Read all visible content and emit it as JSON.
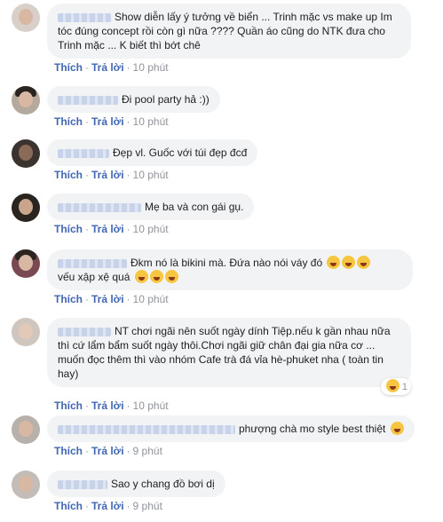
{
  "labels": {
    "like": "Thích",
    "reply": "Trả lời",
    "sep": "·"
  },
  "comments": [
    {
      "text": "Show diễn lấy ý tưởng về biển ... Trinh mặc vs make up Im tóc đúng concept rồi còn gì nữa ???? Quần áo cũng do NTK đưa cho Trinh mặc ... K biết thì bớt chê",
      "time": "10 phút"
    },
    {
      "text": "Đi pool party hả :))",
      "time": "10 phút"
    },
    {
      "text": "Đẹp vl. Guốc với túi đẹp đcđ",
      "time": "10 phút"
    },
    {
      "text": "Mẹ ba và con gái gụ.",
      "time": "10 phút"
    },
    {
      "text": "Đkm nó là bikini mà. Đứa nào nói váy đó",
      "text2": "vếu xập xệ quá",
      "time": "10 phút"
    },
    {
      "text": "NT chơi ngãi nên suốt ngày dính Tiệp.nếu k gần nhau nữa thì cứ lẩm bẩm suốt ngày thôi.Chơi ngãi giữ chân đại gia nữa cơ ... muốn đọc thêm thì vào nhóm Cafe trà đá vỉa hè-phuket nha ( toàn tin hay)",
      "reaction_count": "1",
      "time": "10 phút"
    },
    {
      "text": "phượng chà mo style best thiệt",
      "time": "9 phút"
    },
    {
      "text": "Sao y chang đồ bơi dị",
      "time": "9 phút"
    }
  ]
}
